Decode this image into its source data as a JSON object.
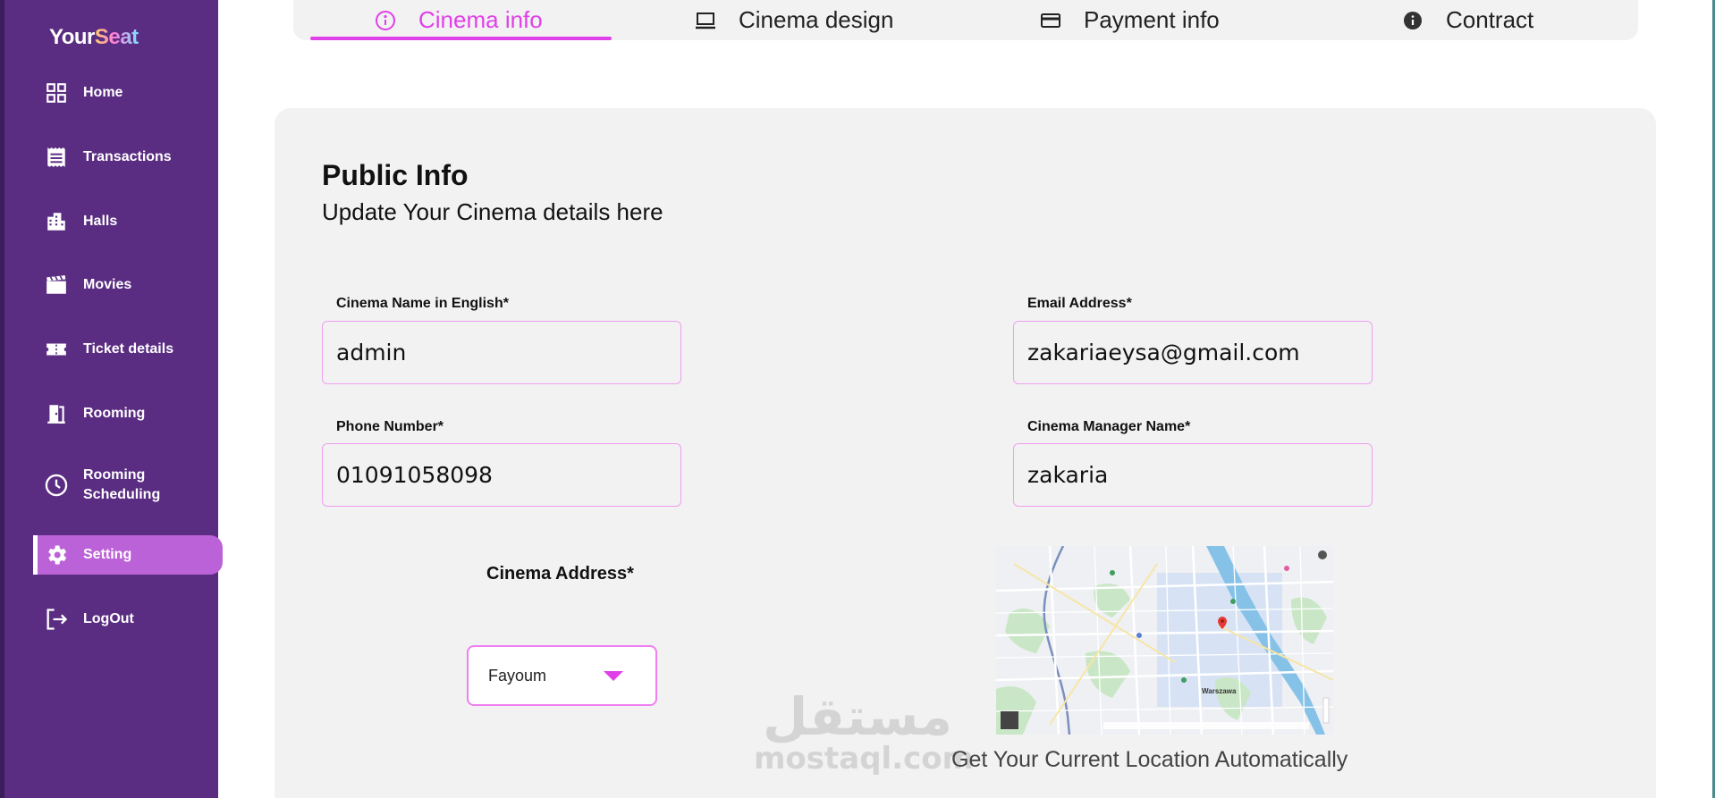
{
  "app": {
    "logo_prefix": "Your",
    "logo_suffix": "Seat"
  },
  "sidebar": {
    "items": [
      {
        "label": "Home",
        "icon": "grid-icon"
      },
      {
        "label": "Transactions",
        "icon": "receipt-icon"
      },
      {
        "label": "Halls",
        "icon": "building-icon"
      },
      {
        "label": "Movies",
        "icon": "clapperboard-icon"
      },
      {
        "label": "Ticket details",
        "icon": "ticket-icon"
      },
      {
        "label": "Rooming",
        "icon": "door-icon"
      },
      {
        "label": "Rooming Scheduling",
        "label_line1": "Rooming",
        "label_line2": "Scheduling",
        "icon": "clock-icon"
      },
      {
        "label": "Setting",
        "icon": "gear-icon",
        "active": true
      },
      {
        "label": "LogOut",
        "icon": "logout-icon"
      }
    ]
  },
  "tabs": [
    {
      "label": "Cinema info",
      "icon": "info-outline-icon",
      "active": true
    },
    {
      "label": "Cinema design",
      "icon": "laptop-icon"
    },
    {
      "label": "Payment info",
      "icon": "credit-card-icon"
    },
    {
      "label": "Contract",
      "icon": "info-filled-icon"
    }
  ],
  "section": {
    "title": "Public Info",
    "subtitle": "Update Your Cinema details here"
  },
  "form": {
    "cinema_name": {
      "label": "Cinema Name in English*",
      "value": "admin"
    },
    "email": {
      "label": "Email Address*",
      "value": "zakariaeysa@gmail.com"
    },
    "phone": {
      "label": "Phone Number*",
      "value": "01091058098"
    },
    "manager": {
      "label": "Cinema Manager Name*",
      "value": "zakaria"
    },
    "address": {
      "label": "Cinema Address*",
      "selected": "Fayoum"
    }
  },
  "map": {
    "city_label": "Warszawa",
    "locate_text": "Get Your Current Location Automatically"
  },
  "watermark": {
    "arabic": "مستقل",
    "latin": "mostaql.com"
  },
  "colors": {
    "sidebar": "#5a2d82",
    "accent": "#e040e8",
    "active_nav": "#bc62d8",
    "card": "#f2f2f2"
  }
}
